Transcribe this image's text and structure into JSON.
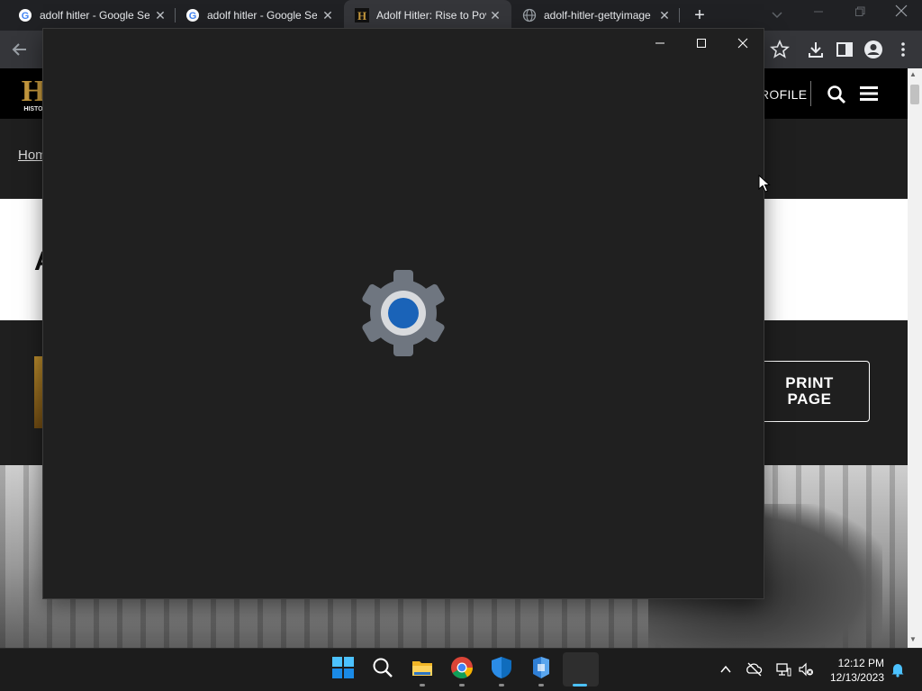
{
  "browser": {
    "tabs": [
      {
        "title": "adolf hitler - Google Se",
        "favicon": "google-icon",
        "active": false
      },
      {
        "title": "adolf hitler - Google Se",
        "favicon": "google-icon",
        "active": false
      },
      {
        "title": "Adolf Hitler: Rise to Pov",
        "favicon": "history-h-icon",
        "active": true
      },
      {
        "title": "adolf-hitler-gettyimage",
        "favicon": "globe-icon",
        "active": false
      }
    ],
    "tab_close_glyph": "✕",
    "new_tab_glyph": "+"
  },
  "site": {
    "profile_label": "ROFILE",
    "breadcrumb": "Hom",
    "title_fragment": "A",
    "print_button_line1": "PRINT",
    "print_button_line2": "PAGE"
  },
  "splash": {
    "app_icon": "settings-gear-icon",
    "colors": {
      "background": "#202020",
      "gear": "#6f7680",
      "center": "#1a63b8"
    }
  },
  "taskbar": {
    "apps": [
      "start-icon",
      "search-icon",
      "file-explorer-icon",
      "chrome-icon",
      "defender-icon",
      "app-icon",
      "settings-app-icon"
    ],
    "time": "12:12 PM",
    "date": "12/13/2023"
  }
}
